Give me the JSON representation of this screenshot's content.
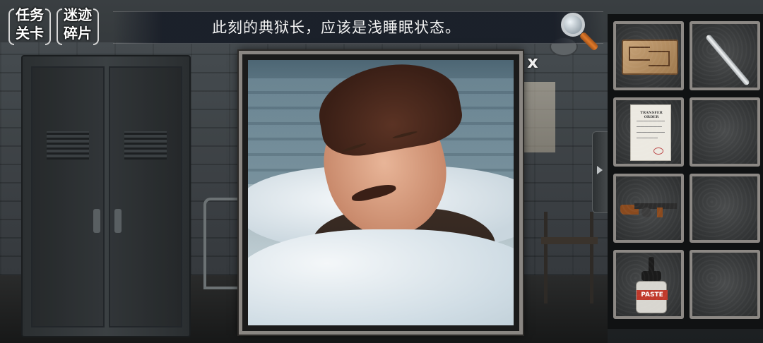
{
  "hud": {
    "task_button": {
      "line1": "任务",
      "line2": "关卡"
    },
    "clue_button": {
      "line1": "迷迹",
      "line2": "碎片"
    },
    "hint_text": "此刻的典狱长，应该是浅睡眠状态。",
    "magnifier_icon": "magnifier-icon"
  },
  "popup": {
    "close_label": "x",
    "image": "sleeping-warden-portrait"
  },
  "inventory": {
    "slots": [
      {
        "item": "maze-map",
        "icon": "maze-map-icon"
      },
      {
        "item": "scalpel",
        "icon": "scalpel-icon"
      },
      {
        "item": "transfer-order",
        "icon": "document-icon",
        "doc_title": "TRANSFER ORDER"
      },
      {
        "item": "",
        "icon": ""
      },
      {
        "item": "tommy-gun",
        "icon": "gun-icon"
      },
      {
        "item": "",
        "icon": ""
      },
      {
        "item": "paste-bottle",
        "icon": "paste-bottle-icon",
        "label": "PASTE"
      },
      {
        "item": "",
        "icon": ""
      }
    ],
    "toggle_icon": "chevron-right-icon"
  },
  "colors": {
    "hud_text": "#f2f2f2",
    "slot_border": "#8c8884",
    "paste_label": "#c0392b"
  }
}
